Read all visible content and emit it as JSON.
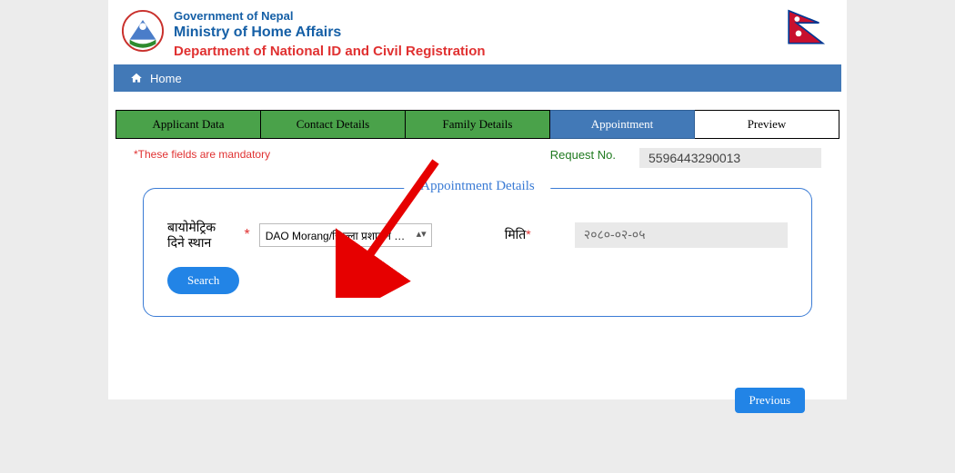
{
  "header": {
    "gov": "Government of Nepal",
    "ministry": "Ministry of Home Affairs",
    "department": "Department of National ID and Civil Registration"
  },
  "nav": {
    "home": "Home"
  },
  "tabs": {
    "t1": "Applicant Data",
    "t2": "Contact Details",
    "t3": "Family Details",
    "t4": "Appointment",
    "t5": "Preview"
  },
  "mandatory_note": "*These fields are mandatory",
  "request_label": "Request No.",
  "request_value": "5596443290013",
  "fieldset_title": "Appointment Details",
  "form": {
    "location_label": "बायोमेट्रिक दिने स्थान",
    "location_value": "DAO Morang/जिल्ला प्रशासन कार्यालय",
    "date_label": "मिति",
    "date_value": "२०८०-०२-०५",
    "search": "Search"
  },
  "buttons": {
    "previous": "Previous"
  }
}
